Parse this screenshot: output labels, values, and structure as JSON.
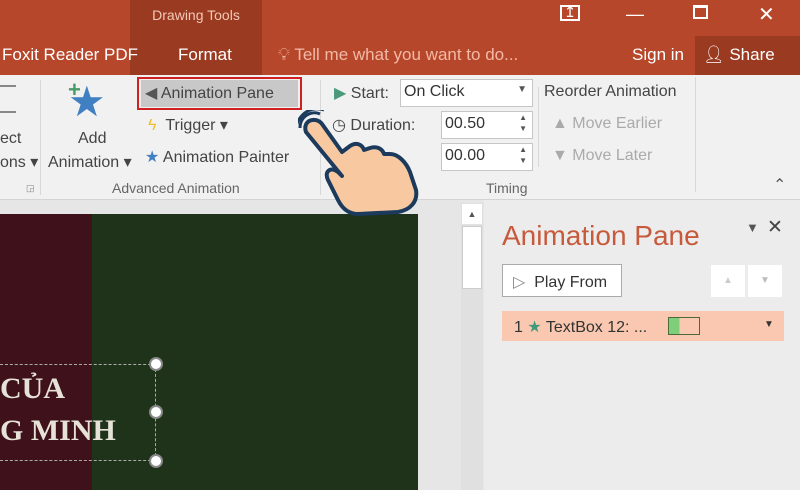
{
  "titlebar": {
    "context_group": "Drawing Tools",
    "tabs": [
      "Foxit Reader PDF",
      "Format"
    ],
    "tell_me": "Tell me what you want to do...",
    "sign_in": "Sign in",
    "share": "Share"
  },
  "ribbon": {
    "left_partial": {
      "line1": "ect",
      "line2": "ons"
    },
    "add_animation": {
      "line1": "Add",
      "line2": "Animation"
    },
    "animation_pane": "Animation Pane",
    "trigger": "Trigger",
    "animation_painter": "Animation Painter",
    "advanced_group": "Advanced Animation",
    "start_label": "Start:",
    "start_value": "On Click",
    "duration_label": "Duration:",
    "duration_value": "00.50",
    "delay_value": "00.00",
    "reorder_title": "Reorder Animation",
    "move_earlier": "Move Earlier",
    "move_later": "Move Later",
    "timing_group": "Timing"
  },
  "slide": {
    "line1": "CỦA",
    "line2": "G MINH"
  },
  "pane": {
    "title": "Animation Pane",
    "play_from": "Play From",
    "item": {
      "number": "1",
      "label": "TextBox 12: ..."
    }
  },
  "colors": {
    "title_bar": "#b7472a",
    "accent": "#c85a3c",
    "highlight": "#fac8b0"
  }
}
